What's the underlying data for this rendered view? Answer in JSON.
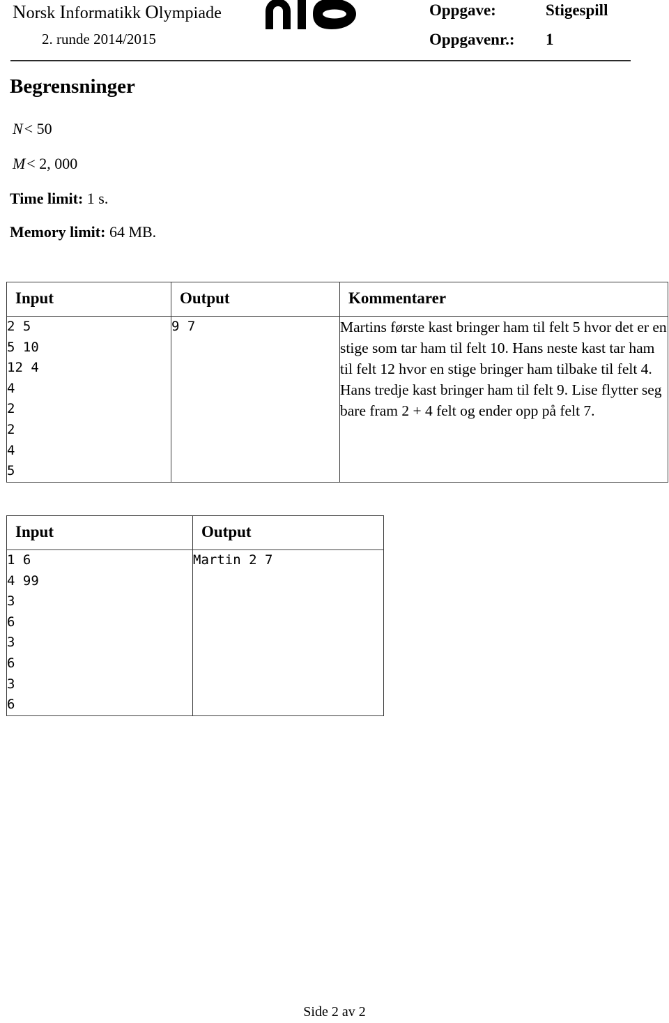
{
  "header": {
    "organization_prefix_n": "N",
    "organization": "orsk ",
    "organization_full": "Norsk Informatikk Olympiade",
    "org_word1_cap": "N",
    "org_word1_rest": "orsk",
    "org_word2_cap": "I",
    "org_word2_rest": "nformatikk",
    "org_word3_cap": "O",
    "org_word3_rest": "lympiade",
    "round": "2. runde 2014/2015",
    "task_label": "Oppgave:",
    "task_value": "Stigespill",
    "task_number_label": "Oppgavenr.:",
    "task_number_value": "1",
    "logo_name": "nio"
  },
  "section": {
    "title": "Begrensninger",
    "constraint_n_var": "N",
    "constraint_n_rest": "< 50",
    "constraint_m_var": "M",
    "constraint_m_rest": "< 2, 000",
    "time_limit_label": "Time limit:",
    "time_limit_value": "1 s.",
    "memory_limit_label": "Memory limit:",
    "memory_limit_value": "64 MB."
  },
  "example_table_1": {
    "columns": [
      "Input",
      "Output",
      "Kommentarer"
    ],
    "input": "2 5\n5 10\n12 4\n4\n2\n2\n4\n5",
    "output": "9 7",
    "comment": "Martins første kast bringer ham til felt 5 hvor det er en stige som tar ham til felt 10. Hans neste kast tar ham til felt 12 hvor en stige bringer ham tilbake til felt 4. Hans tredje kast bringer ham til felt 9. Lise flytter seg bare fram 2 + 4 felt og ender opp på felt 7."
  },
  "example_table_2": {
    "columns": [
      "Input",
      "Output"
    ],
    "input": "1 6\n4 99\n3\n6\n3\n6\n3\n6",
    "output": "Martin 2 7"
  },
  "footer": {
    "page_indicator": "Side 2 av 2"
  },
  "colors": {
    "text": "#000000",
    "rule": "#2b2b2b",
    "table_border": "#3a3a3a",
    "background": "#ffffff"
  }
}
